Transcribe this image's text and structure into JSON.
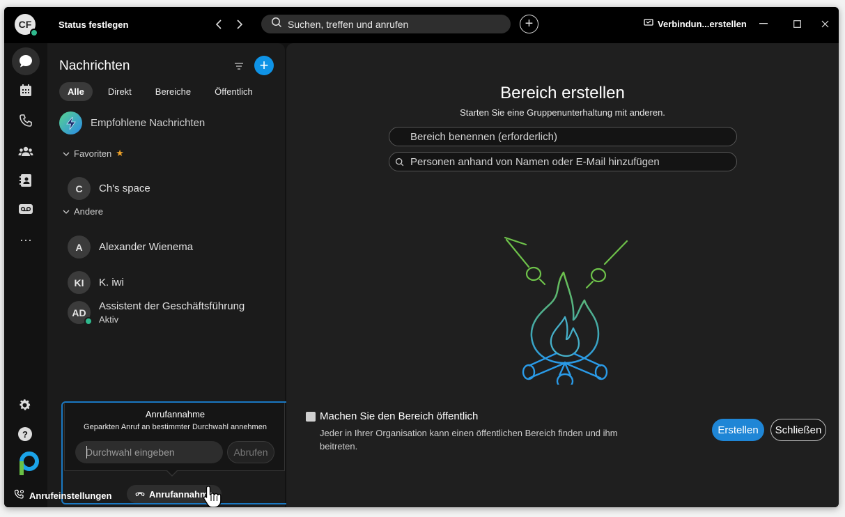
{
  "titlebar": {
    "avatar_initials": "CF",
    "status": "Status festlegen",
    "search_placeholder": "Suchen, treffen und anrufen",
    "connection": "Verbindun...erstellen"
  },
  "nav": {
    "title": "Nachrichten",
    "tabs": [
      "Alle",
      "Direkt",
      "Bereiche",
      "Öffentlich"
    ],
    "recommended": "Empfohlene Nachrichten",
    "favorites_label": "Favoriten",
    "others_label": "Andere",
    "favorites": [
      {
        "initials": "C",
        "name": "Ch's space"
      }
    ],
    "others": [
      {
        "initials": "A",
        "name": "Alexander Wienema"
      },
      {
        "initials": "KI",
        "name": "K. iwi"
      },
      {
        "initials": "AD",
        "name": "Assistent der Geschäftsführung",
        "status": "Aktiv"
      }
    ]
  },
  "popup": {
    "title": "Anrufannahme",
    "description": "Geparkten Anruf an bestimmter Durchwahl annehmen",
    "input_placeholder": "Durchwahl eingeben",
    "retrieve_label": "Abrufen"
  },
  "bottom": {
    "call_settings": "Anrufeinstellungen",
    "pickup": "Anrufannahme"
  },
  "main": {
    "title": "Bereich erstellen",
    "subtitle": "Starten Sie eine Gruppenunterhaltung mit anderen.",
    "name_placeholder": "Bereich benennen (erforderlich)",
    "people_placeholder": "Personen anhand von Namen oder E-Mail hinzufügen",
    "public_label": "Machen Sie den Bereich öffentlich",
    "public_desc": "Jeder in Ihrer Organisation kann einen öffentlichen Bereich finden und ihm beitreten.",
    "create_label": "Erstellen",
    "close_label": "Schließen"
  },
  "colors": {
    "accent": "#1f86d6",
    "presence": "#2fb98d",
    "star": "#f0a329"
  }
}
